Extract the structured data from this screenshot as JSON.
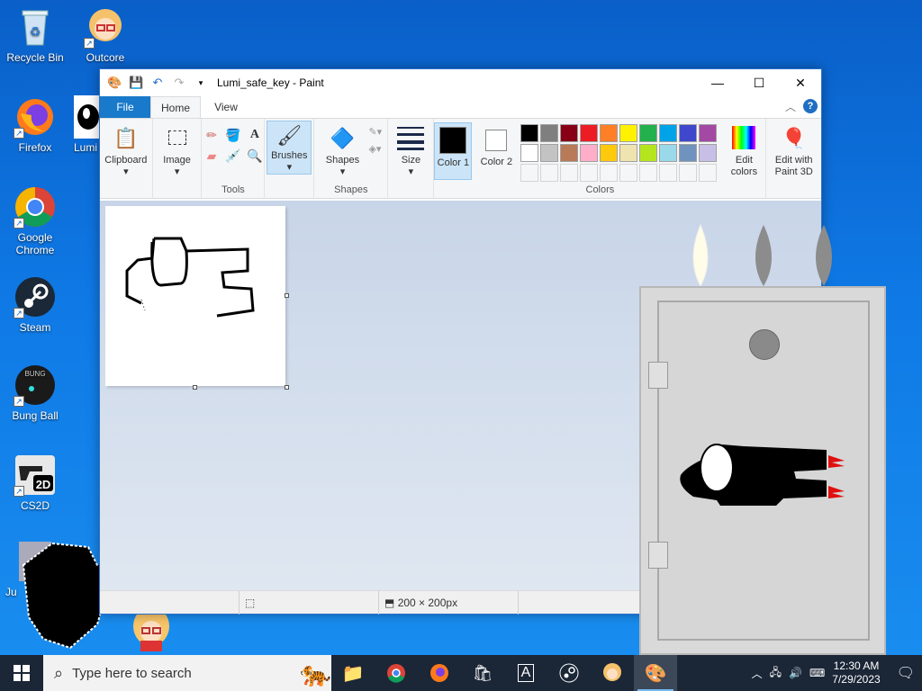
{
  "desktop": {
    "icons": [
      {
        "label": "Recycle Bin"
      },
      {
        "label": "Outcore"
      },
      {
        "label": "Firefox"
      },
      {
        "label": "Lumi"
      },
      {
        "label": "Google Chrome"
      },
      {
        "label": "Steam"
      },
      {
        "label": "Bung Ball"
      },
      {
        "label": "CS2D"
      },
      {
        "label": "Ju"
      }
    ]
  },
  "paint": {
    "title": "Lumi_safe_key - Paint",
    "tabs": {
      "file": "File",
      "home": "Home",
      "view": "View"
    },
    "ribbon": {
      "clipboard": "Clipboard",
      "image": "Image",
      "tools_group": "Tools",
      "brushes": "Brushes",
      "shapes_btn": "Shapes",
      "shapes_group": "Shapes",
      "size": "Size",
      "color1": "Color 1",
      "color2": "Color 2",
      "edit_colors": "Edit colors",
      "edit_paint3d": "Edit with Paint 3D",
      "colors_group": "Colors"
    },
    "palette_row1": [
      "#000000",
      "#7f7f7f",
      "#880015",
      "#ed1c24",
      "#ff7f27",
      "#fff200",
      "#22b14c",
      "#00a2e8",
      "#3f48cc",
      "#a349a4"
    ],
    "palette_row2": [
      "#ffffff",
      "#c3c3c3",
      "#b97a57",
      "#ffaec9",
      "#ffc90e",
      "#efe4b0",
      "#b5e61d",
      "#99d9ea",
      "#7092be",
      "#c8bfe7"
    ],
    "color1_value": "#000000",
    "color2_value": "#ffffff",
    "status": {
      "dimensions": "200 × 200px"
    }
  },
  "taskbar": {
    "search_placeholder": "Type here to search",
    "time": "12:30 AM",
    "date": "7/29/2023"
  }
}
